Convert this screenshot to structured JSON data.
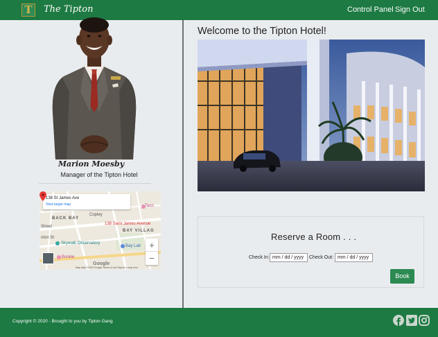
{
  "navbar": {
    "logo_letter": "T",
    "brand": "The Tipton",
    "links": {
      "control_panel": "Control Panel",
      "sign_out": "Sign Out"
    }
  },
  "manager": {
    "name": "Marion Moesby",
    "title": "Manager of the Tipton Hotel"
  },
  "map": {
    "address": "138 St James Ave",
    "view_larger": "View larger map",
    "pin_label": "138 Saint James Avenue",
    "labels": [
      "BACK BAY",
      "BAY VILLAG",
      "Copley",
      "Skywalk Observatory",
      "Taco",
      "Bay Lab",
      "Bookie",
      "Street",
      "nton St"
    ],
    "zoom_in": "+",
    "zoom_out": "−",
    "brand": "Google",
    "footer": "Map data ©2020 Google   Terms of Use   Report a map error"
  },
  "main": {
    "welcome": "Welcome to the Tipton Hotel!"
  },
  "reserve": {
    "title": "Reserve a Room . . .",
    "check_in_label": "Check In:",
    "check_out_label": "Check Out:",
    "check_in_placeholder": "mm / dd / yyyy",
    "check_out_placeholder": "mm / dd / yyyy",
    "book_label": "Book"
  },
  "footer": {
    "copyright": "Copyright © 2020 - Brought to you by Tipton Gang",
    "icons": [
      "facebook-icon",
      "twitter-icon",
      "instagram-icon"
    ]
  },
  "colors": {
    "brand_green": "#1d7a42",
    "button_green": "#2c8a52",
    "panel_bg": "#e9ecef",
    "logo_gold": "#d9b64a"
  }
}
